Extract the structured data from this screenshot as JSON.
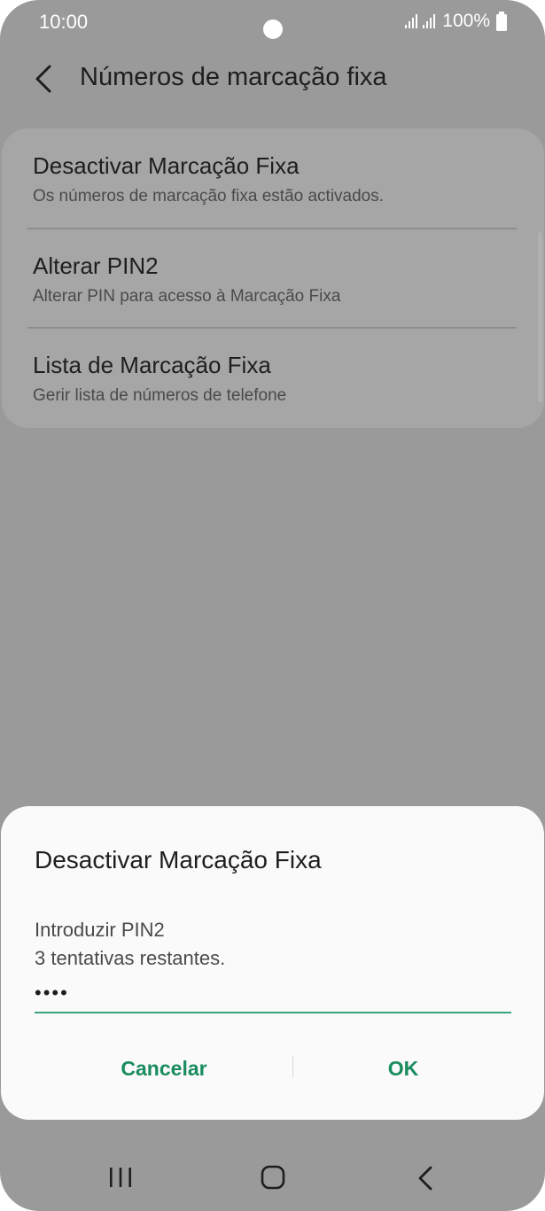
{
  "status_bar": {
    "time": "10:00",
    "battery": "100%"
  },
  "header": {
    "title": "Números de marcação fixa"
  },
  "settings": {
    "items": [
      {
        "title": "Desactivar Marcação Fixa",
        "subtitle": "Os números de marcação fixa estão activados."
      },
      {
        "title": "Alterar PIN2",
        "subtitle": "Alterar PIN para acesso à Marcação Fixa"
      },
      {
        "title": "Lista de Marcação Fixa",
        "subtitle": "Gerir lista de números de telefone"
      }
    ]
  },
  "dialog": {
    "title": "Desactivar Marcação Fixa",
    "label": "Introduzir PIN2",
    "attempts": "3 tentativas restantes.",
    "pin_value": "••••",
    "cancel_label": "Cancelar",
    "ok_label": "OK"
  },
  "colors": {
    "accent": "#1a8c5e",
    "input_underline": "#3aa57a",
    "dim_background": "#9a9a9a",
    "dialog_background": "#fafafa"
  },
  "icons": {
    "back": "back-chevron-icon",
    "signal": "signal-icon",
    "battery": "battery-icon",
    "recents": "recents-icon",
    "home": "home-icon",
    "nav_back": "nav-back-icon"
  }
}
